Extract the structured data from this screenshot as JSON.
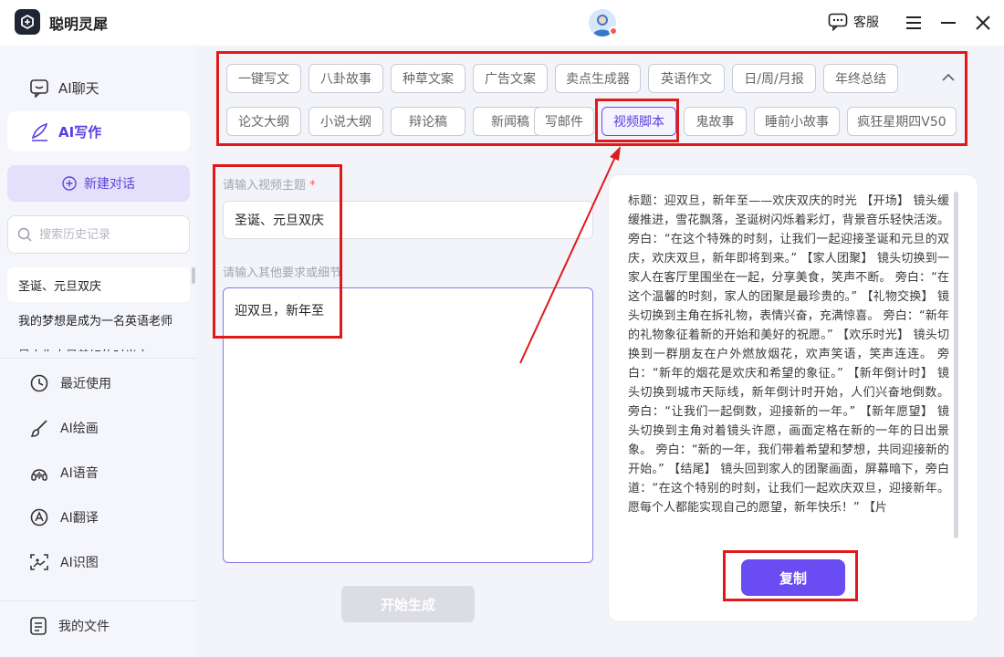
{
  "app": {
    "title": "聪明灵犀",
    "service_label": "客服"
  },
  "sidebar": {
    "nav": [
      {
        "label": "AI聊天",
        "icon": "chat-icon"
      },
      {
        "label": "AI写作",
        "icon": "pen-icon"
      }
    ],
    "new_chat_label": "新建对话",
    "search_placeholder": "搜索历史记录",
    "history": [
      "圣诞、元旦双庆",
      "我的梦想是成为一名英语老师",
      "是人生中最美好的时光之一"
    ],
    "tools": [
      {
        "label": "最近使用",
        "icon": "history-icon"
      },
      {
        "label": "AI绘画",
        "icon": "brush-icon"
      },
      {
        "label": "AI语音",
        "icon": "voice-icon"
      },
      {
        "label": "AI翻译",
        "icon": "translate-icon"
      },
      {
        "label": "AI识图",
        "icon": "scan-image-icon"
      }
    ],
    "my_files_label": "我的文件"
  },
  "tags": {
    "row1": [
      "一键写文",
      "八卦故事",
      "种草文案",
      "广告文案",
      "卖点生成器",
      "英语作文",
      "日/周/月报",
      "年终总结"
    ],
    "row2": [
      "论文大纲",
      "小说大纲",
      "辩论稿",
      "新闻稿",
      "写邮件",
      "视频脚本",
      "鬼故事",
      "睡前小故事",
      "疯狂星期四V50"
    ],
    "selected": "视频脚本"
  },
  "form": {
    "topic_label": "请输入视频主题",
    "required_mark": "*",
    "topic_value": "圣诞、元旦双庆",
    "detail_label": "请输入其他要求或细节",
    "detail_value": "迎双旦，新年至",
    "generate_label": "开始生成"
  },
  "result": {
    "text": "标题：迎双旦，新年至——欢庆双庆的时光 【开场】 镜头缓缓推进，雪花飘落，圣诞树闪烁着彩灯，背景音乐轻快活泼。 旁白：“在这个特殊的时刻，让我们一起迎接圣诞和元旦的双庆，欢庆双旦，新年即将到来。” 【家人团聚】 镜头切换到一家人在客厅里围坐在一起，分享美食，笑声不断。 旁白：“在这个温馨的时刻，家人的团聚是最珍贵的。” 【礼物交换】 镜头切换到主角在拆礼物，表情兴奋，充满惊喜。 旁白：“新年的礼物象征着新的开始和美好的祝愿。” 【欢乐时光】 镜头切换到一群朋友在户外燃放烟花，欢声笑语，笑声连连。 旁白：“新年的烟花是欢庆和希望的象征。” 【新年倒计时】 镜头切换到城市天际线，新年倒计时开始，人们兴奋地倒数。 旁白：“让我们一起倒数，迎接新的一年。” 【新年愿望】 镜头切换到主角对着镜头许愿，画面定格在新的一年的日出景象。 旁白：“新的一年，我们带着希望和梦想，共同迎接新的开始。” 【结尾】 镜头回到家人的团聚画面，屏幕暗下，旁白道：“在这个特别的时刻，让我们一起欢庆双旦，迎接新年。愿每个人都能实现自己的愿望，新年快乐！” 【片",
    "copy_label": "复制"
  },
  "colors": {
    "accent": "#6a4df2",
    "annotation": "#e01a1a"
  }
}
